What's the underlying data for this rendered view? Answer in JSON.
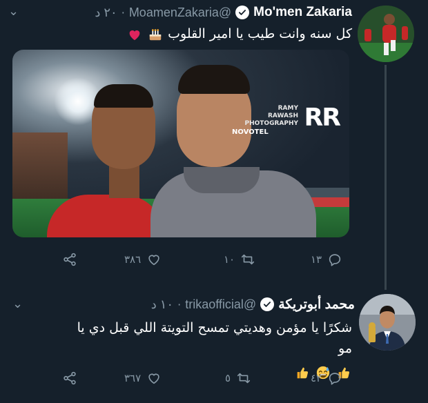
{
  "tweets": [
    {
      "display_name": "Mo'men Zakaria",
      "handle": "@MoamenZakaria",
      "separator": "·",
      "time": "٢٠ د",
      "text": "كل سنه وانت طيب يا امير القلوب",
      "emojis": [
        "birthday-cake",
        "red-heart"
      ],
      "photo": {
        "watermark_lines": [
          "RAMY",
          "RAWASH",
          "PHOTOGRAPHY"
        ],
        "watermark_logo": "RR",
        "background_sign": "NOVOTEL"
      },
      "actions": {
        "replies": "١٣",
        "retweets": "١٠",
        "likes": "٣٨٦"
      }
    },
    {
      "display_name": "محمد أبوتريكة",
      "handle": "@trikaofficial",
      "separator": "·",
      "time": "١٠ د",
      "text": "شكرًا يا مؤمن وهديتي تمسح التويتة اللي قبل دي يا مو",
      "emojis": [
        "thumbs-up",
        "grinning-sweat",
        "thumbs-up"
      ],
      "actions": {
        "replies": "٤٢",
        "retweets": "٥",
        "likes": "٣٦٧"
      }
    }
  ],
  "colors": {
    "background": "#15202b",
    "secondary_text": "#8899a6",
    "thread_line": "#38444d"
  },
  "icons": [
    "chevron-down-icon",
    "verified-badge-icon",
    "reply-icon",
    "retweet-icon",
    "like-icon",
    "share-icon"
  ]
}
